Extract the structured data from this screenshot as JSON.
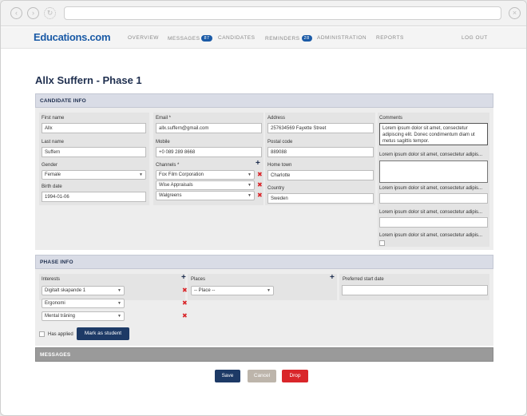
{
  "header": {
    "logo": "Educations.com",
    "nav": [
      {
        "label": "OVERVIEW"
      },
      {
        "label": "MESSAGES",
        "badge": "87"
      },
      {
        "label": "CANDIDATES"
      },
      {
        "label": "REMINDERS",
        "badge": "28"
      },
      {
        "label": "ADMINISTRATION"
      },
      {
        "label": "REPORTS"
      }
    ],
    "logout": "LOG OUT"
  },
  "page": {
    "title": "Allx Suffern - Phase 1"
  },
  "candidate_info": {
    "header": "CANDIDATE INFO",
    "first_name": {
      "label": "First name",
      "value": "Allx"
    },
    "last_name": {
      "label": "Last name",
      "value": "Suffern"
    },
    "gender": {
      "label": "Gender",
      "value": "Female"
    },
    "birth_date": {
      "label": "Birth date",
      "value": "1994-01-06"
    },
    "email": {
      "label": "Email *",
      "value": "allx.suffern@gmail.com"
    },
    "mobile": {
      "label": "Mobile",
      "value": "+0 089 289 8668"
    },
    "channels": {
      "label": "Channels *",
      "values": [
        "Fox Film Corporation",
        "Wise Appraisals",
        "Walgreens"
      ]
    },
    "address": {
      "label": "Address",
      "value": "257634569 Fayette Street"
    },
    "postal_code": {
      "label": "Postal code",
      "value": "889088"
    },
    "home_town": {
      "label": "Home town",
      "value": "Charlotte"
    },
    "country": {
      "label": "Country",
      "value": "Sweden"
    },
    "comments": {
      "label": "Comments",
      "text": "Lorem ipsum dolor sit amet, consectetur adipiscing elit. Donec condimentum diam ut metus sagittis tempor.",
      "entries": [
        "Lorem ipsum dolor sit amet, consectetur adipis...",
        "Lorem ipsum dolor sit amet, consectetur adipis...",
        "Lorem ipsum dolor sit amet, consectetur adipis...",
        "Lorem ipsum dolor sit amet, consectetur adipis..."
      ]
    }
  },
  "phase_info": {
    "header": "PHASE INFO",
    "interests": {
      "label": "Interests",
      "values": [
        "Digitalt skapande 1",
        "Ergonomi",
        "Mental träning"
      ]
    },
    "places": {
      "label": "Places",
      "value": "-- Place --"
    },
    "preferred_start": {
      "label": "Preferred start date",
      "value": ""
    },
    "has_applied": "Has applied",
    "mark_as_student": "Mark as student"
  },
  "messages": {
    "header": "MESSAGES"
  },
  "actions": {
    "save": "Save",
    "cancel": "Cancel",
    "drop": "Drop"
  },
  "colors": {
    "brand": "#1a5aa6",
    "primary_button": "#1d3a66",
    "cancel_button": "#bdb5ab",
    "drop_button": "#d9262a",
    "delete_icon": "#d9262a"
  }
}
